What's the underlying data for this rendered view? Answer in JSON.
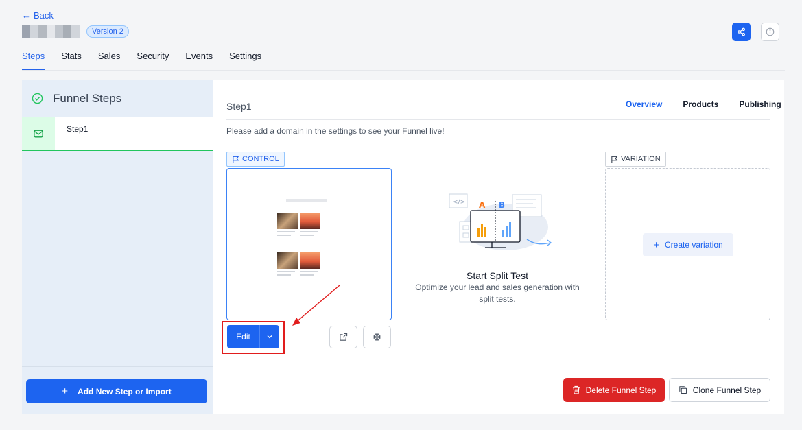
{
  "header": {
    "back_label": "Back",
    "version_badge": "Version 2"
  },
  "nav_tabs": [
    {
      "label": "Steps",
      "active": true
    },
    {
      "label": "Stats",
      "active": false
    },
    {
      "label": "Sales",
      "active": false
    },
    {
      "label": "Security",
      "active": false
    },
    {
      "label": "Events",
      "active": false
    },
    {
      "label": "Settings",
      "active": false
    }
  ],
  "sidebar": {
    "title": "Funnel Steps",
    "steps": [
      {
        "label": "Step1",
        "selected": true
      }
    ],
    "add_button_label": "Add New Step or Import"
  },
  "main": {
    "step_title": "Step1",
    "tabs": [
      {
        "label": "Overview",
        "active": true
      },
      {
        "label": "Products",
        "active": false
      },
      {
        "label": "Publishing",
        "active": false
      }
    ],
    "notice": "Please add a domain in the settings to see your Funnel live!",
    "control": {
      "tag_label": "CONTROL",
      "edit_label": "Edit"
    },
    "split_test": {
      "title": "Start Split Test",
      "description": "Optimize your lead and sales generation with split tests.",
      "illus_a": "A",
      "illus_b": "B"
    },
    "variation": {
      "tag_label": "VARIATION",
      "create_label": "Create variation"
    },
    "delete_label": "Delete Funnel Step",
    "clone_label": "Clone Funnel Step"
  },
  "colors": {
    "primary": "#1d64f0",
    "danger": "#dc2626",
    "success": "#22c55e",
    "annotation": "#e11d1d"
  }
}
